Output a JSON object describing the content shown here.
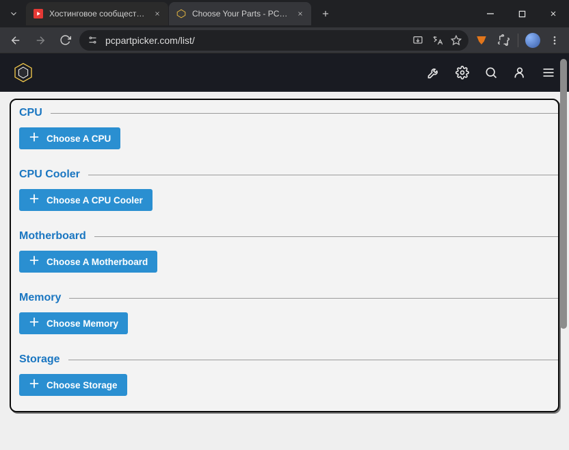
{
  "browser": {
    "tabs": [
      {
        "label": "Хостинговое сообщество «Tim",
        "active": false
      },
      {
        "label": "Choose Your Parts - PCPartPicke",
        "active": true
      }
    ],
    "url": "pcpartpicker.com/list/"
  },
  "site": {
    "nav_icons": [
      "tools",
      "settings",
      "search",
      "user",
      "menu"
    ]
  },
  "sections": [
    {
      "title": "CPU",
      "button": "Choose A CPU"
    },
    {
      "title": "CPU Cooler",
      "button": "Choose A CPU Cooler"
    },
    {
      "title": "Motherboard",
      "button": "Choose A Motherboard"
    },
    {
      "title": "Memory",
      "button": "Choose Memory"
    },
    {
      "title": "Storage",
      "button": "Choose Storage"
    }
  ]
}
